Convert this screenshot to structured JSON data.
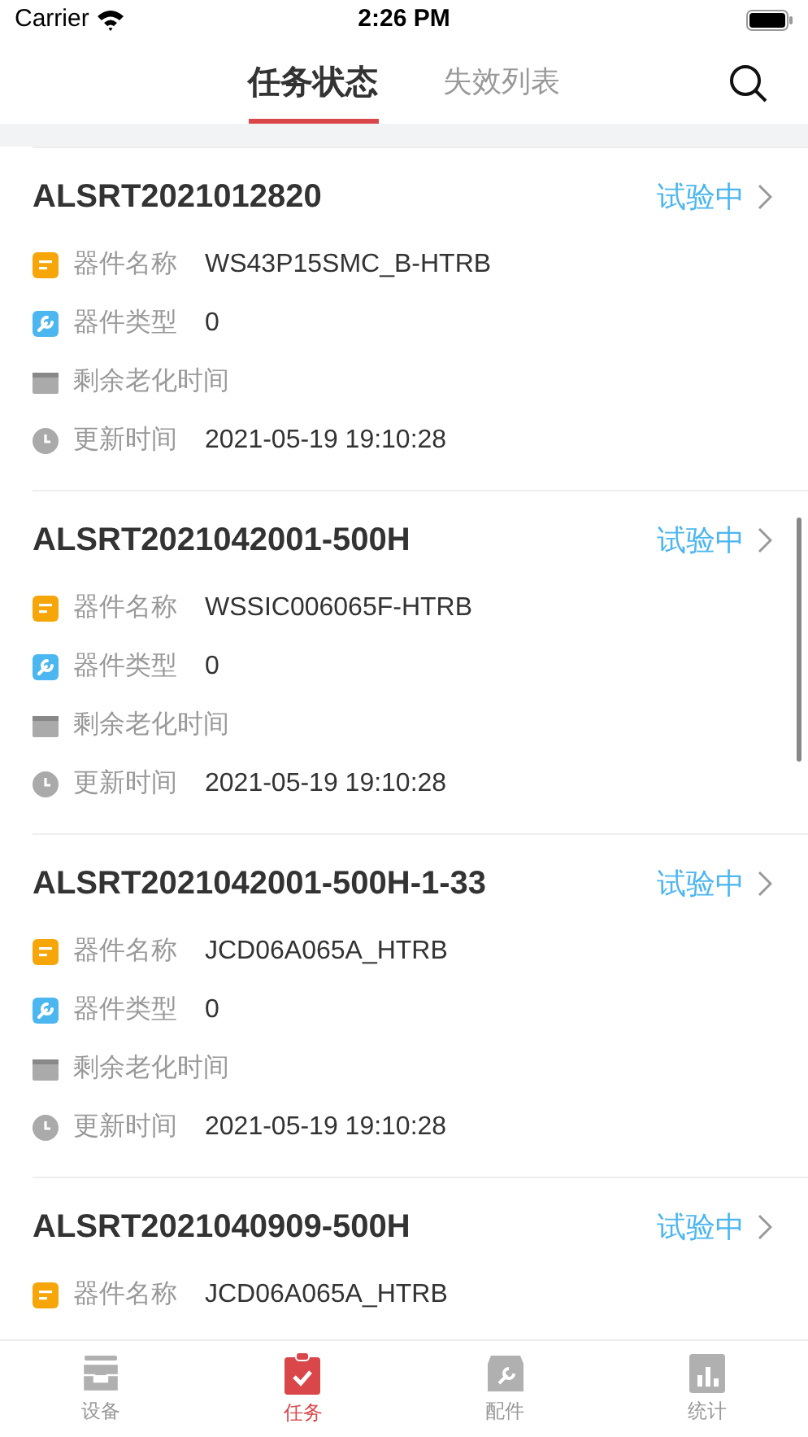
{
  "status_bar": {
    "carrier": "Carrier",
    "time": "2:26 PM"
  },
  "tabs": [
    {
      "label": "任务状态",
      "selected": true
    },
    {
      "label": "失效列表",
      "selected": false
    }
  ],
  "tasks": [
    {
      "title": "ALSRT2021012820",
      "status": "试验中",
      "fields": [
        {
          "kind": "name",
          "label": "器件名称",
          "value": "WS43P15SMC_B-HTRB"
        },
        {
          "kind": "type",
          "label": "器件类型",
          "value": "0"
        },
        {
          "kind": "remaining",
          "label": "剩余老化时间"
        },
        {
          "kind": "updated",
          "label": "更新时间",
          "value": "2021-05-19 19:10:28"
        }
      ]
    },
    {
      "title": "ALSRT2021042001-500H",
      "status": "试验中",
      "fields": [
        {
          "kind": "name",
          "label": "器件名称",
          "value": "WSSIC006065F-HTRB"
        },
        {
          "kind": "type",
          "label": "器件类型",
          "value": "0"
        },
        {
          "kind": "remaining",
          "label": "剩余老化时间"
        },
        {
          "kind": "updated",
          "label": "更新时间",
          "value": "2021-05-19 19:10:28"
        }
      ]
    },
    {
      "title": "ALSRT2021042001-500H-1-33",
      "status": "试验中",
      "fields": [
        {
          "kind": "name",
          "label": "器件名称",
          "value": "JCD06A065A_HTRB"
        },
        {
          "kind": "type",
          "label": "器件类型",
          "value": "0"
        },
        {
          "kind": "remaining",
          "label": "剩余老化时间"
        },
        {
          "kind": "updated",
          "label": "更新时间",
          "value": "2021-05-19 19:10:28"
        }
      ]
    },
    {
      "title": "ALSRT2021040909-500H",
      "status": "试验中",
      "fields": [
        {
          "kind": "name",
          "label": "器件名称",
          "value": "JCD06A065A_HTRB"
        }
      ]
    }
  ],
  "tab_bar": [
    {
      "kind": "devices",
      "label": "设备",
      "selected": false
    },
    {
      "kind": "tasks",
      "label": "任务",
      "selected": true
    },
    {
      "kind": "parts",
      "label": "配件",
      "selected": false
    },
    {
      "kind": "stats",
      "label": "统计",
      "selected": false
    }
  ]
}
